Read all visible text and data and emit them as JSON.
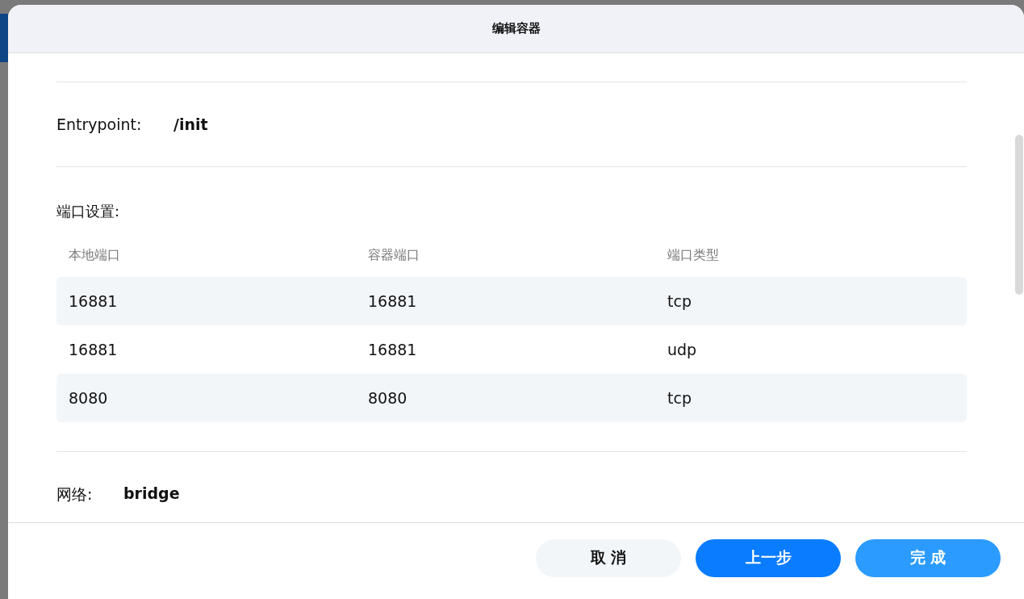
{
  "dialog": {
    "title": "编辑容器"
  },
  "entrypoint": {
    "label": "Entrypoint:",
    "value": "/init"
  },
  "ports": {
    "label": "端口设置:",
    "columns": [
      "本地端口",
      "容器端口",
      "端口类型"
    ],
    "rows": [
      [
        "16881",
        "16881",
        "tcp"
      ],
      [
        "16881",
        "16881",
        "udp"
      ],
      [
        "8080",
        "8080",
        "tcp"
      ]
    ]
  },
  "network": {
    "label": "网络:",
    "value": "bridge"
  },
  "buttons": [
    {
      "label": "取 消",
      "kind": "secondary"
    },
    {
      "label": "上一步",
      "kind": "primary"
    },
    {
      "label": "完 成",
      "kind": "accent"
    }
  ]
}
